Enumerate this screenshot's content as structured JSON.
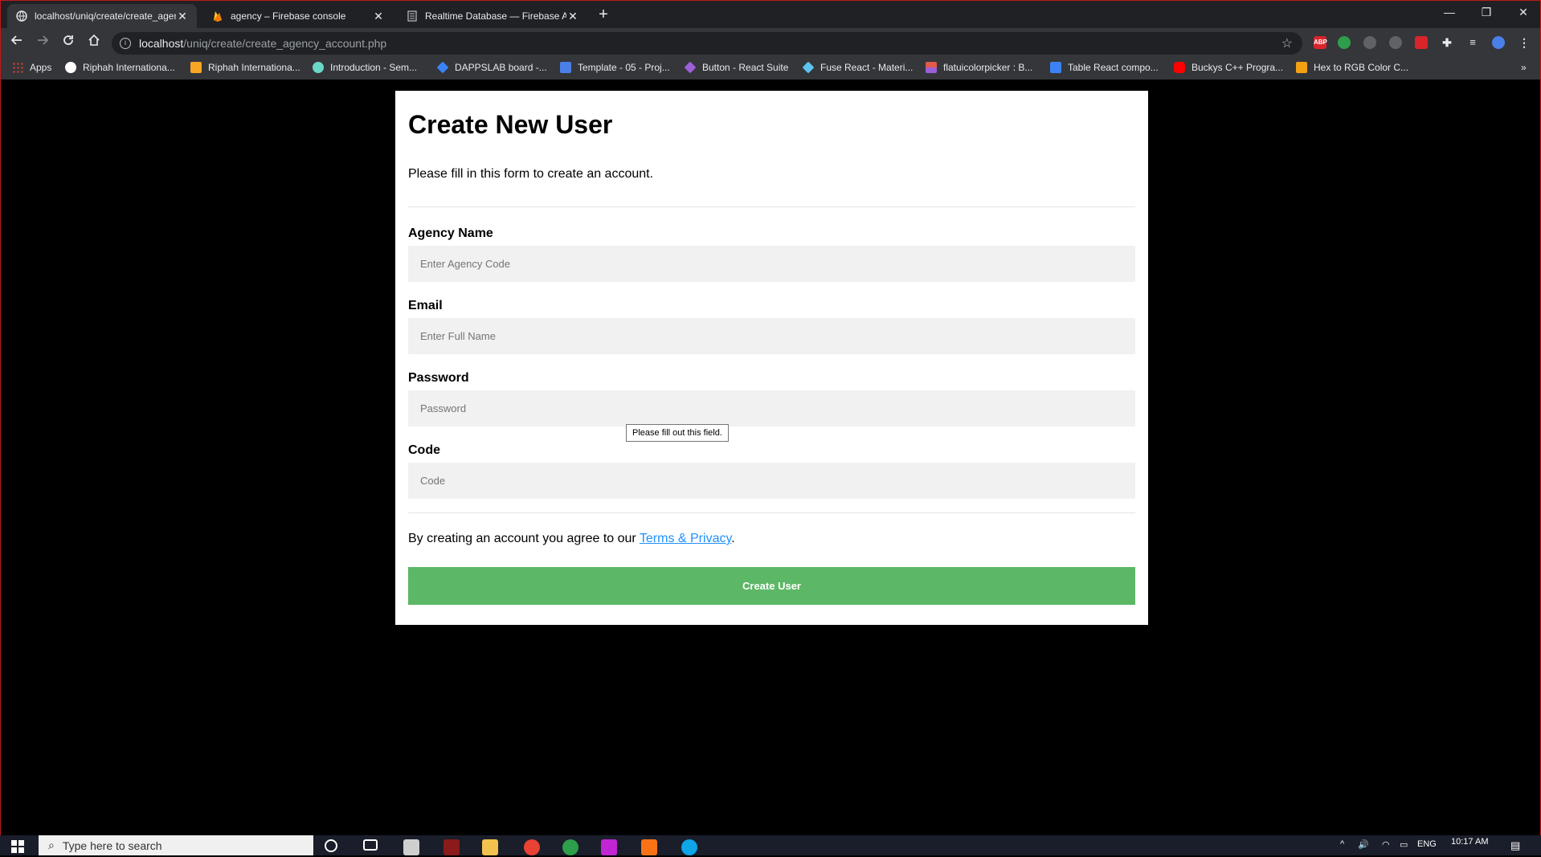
{
  "browser": {
    "tabs": [
      {
        "title": "localhost/uniq/create/create_agency_account.php",
        "active": true
      },
      {
        "title": "agency – Firebase console",
        "active": false
      },
      {
        "title": "Realtime Database — Firebase A",
        "active": false
      }
    ],
    "new_tab_symbol": "+",
    "window_controls": {
      "minimize": "—",
      "restore": "❐",
      "close": "✕"
    },
    "url": {
      "host": "localhost",
      "path": "/uniq/create/create_agency_account.php"
    },
    "extensions": [
      {
        "name": "ABP",
        "color": "#d9242b"
      },
      {
        "name": "",
        "color": "#2d9e4a"
      },
      {
        "name": "",
        "color": "#7a7a7a"
      },
      {
        "name": "",
        "color": "#5f6368"
      },
      {
        "name": "",
        "color": "#d9242b"
      },
      {
        "name": "",
        "color": "#5f6368"
      }
    ],
    "bookmarks": [
      {
        "label": "Apps",
        "color": "#e94235"
      },
      {
        "label": "Riphah Internationa...",
        "color": "#ffffff"
      },
      {
        "label": "Riphah Internationa...",
        "color": "#f6a623"
      },
      {
        "label": "Introduction - Sem...",
        "color": "#6bd7c8"
      },
      {
        "label": "DAPPSLAB board -...",
        "color": "#3b82f6"
      },
      {
        "label": "Template - 05 - Proj...",
        "color": "#4a7fe8"
      },
      {
        "label": "Button - React Suite",
        "color": "#9b5fd8"
      },
      {
        "label": "Fuse React - Materi...",
        "color": "#5ec3f2"
      },
      {
        "label": "flatuicolorpicker : B...",
        "color": "#e25a4a"
      },
      {
        "label": "Table React compo...",
        "color": "#3b82f6"
      },
      {
        "label": "Buckys C++ Progra...",
        "color": "#ff0000"
      },
      {
        "label": "Hex to RGB Color C...",
        "color": "#f2a114"
      }
    ],
    "bookmarks_overflow": "»"
  },
  "form": {
    "title": "Create New User",
    "lead": "Please fill in this form to create an account.",
    "fields": [
      {
        "label": "Agency Name",
        "placeholder": "Enter Agency Code"
      },
      {
        "label": "Email",
        "placeholder": "Enter Full Name"
      },
      {
        "label": "Password",
        "placeholder": "Password"
      },
      {
        "label": "Code",
        "placeholder": "Code"
      }
    ],
    "validation_tooltip": "Please fill out this field.",
    "terms_prefix": "By creating an account you agree to our ",
    "terms_link": "Terms & Privacy",
    "terms_suffix": ".",
    "submit_label": "Create User",
    "submit_color": "#5cb766",
    "link_color": "#1e90ff"
  },
  "taskbar": {
    "search_placeholder": "Type here to search",
    "language": "ENG",
    "time": "10:17 AM"
  }
}
